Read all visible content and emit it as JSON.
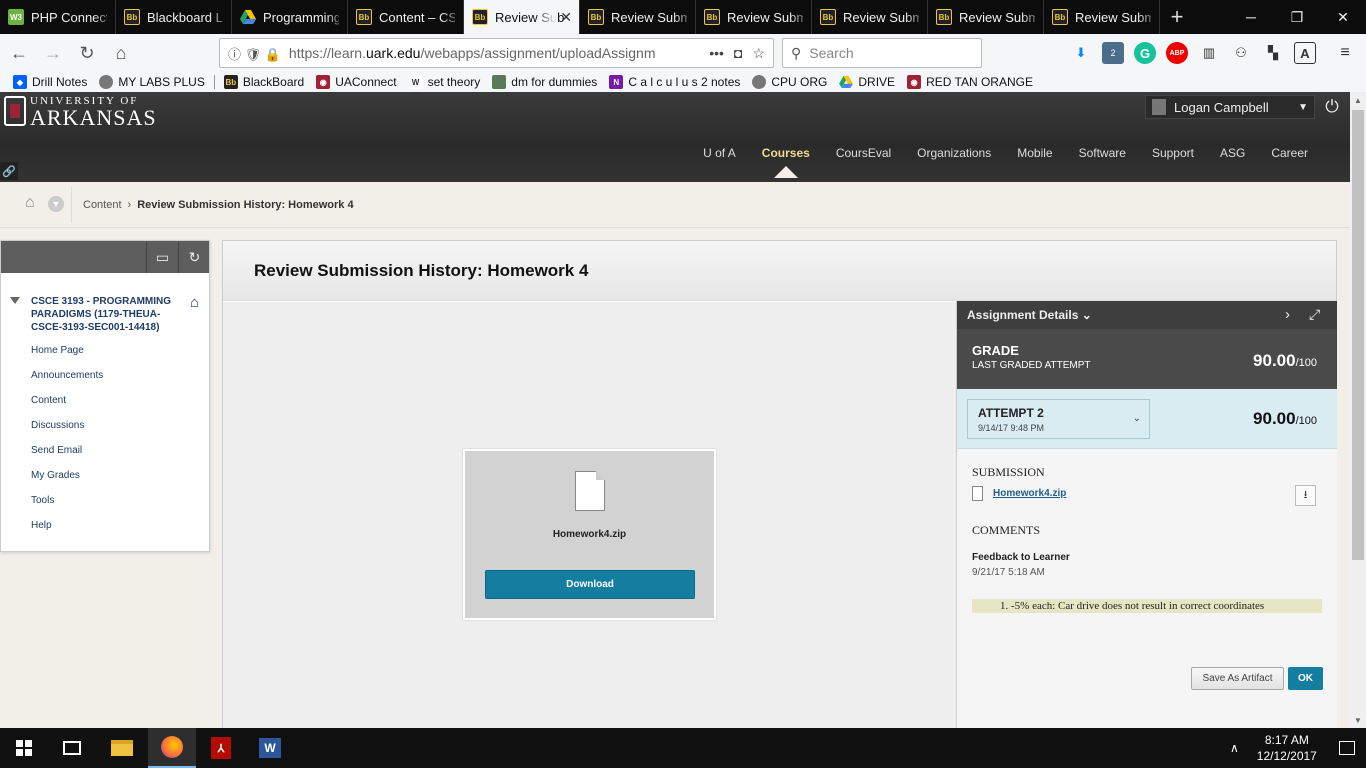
{
  "browser": {
    "tabs": [
      {
        "label": "PHP Connect",
        "favicon": "php-icon",
        "active": false
      },
      {
        "label": "Blackboard Le",
        "favicon": "blackboard-icon",
        "active": false
      },
      {
        "label": "Programming",
        "favicon": "google-drive-icon",
        "active": false
      },
      {
        "label": "Content – CSC",
        "favicon": "blackboard-icon",
        "active": false
      },
      {
        "label": "Review Sub",
        "favicon": "blackboard-icon",
        "active": true
      },
      {
        "label": "Review Subm",
        "favicon": "blackboard-icon",
        "active": false
      },
      {
        "label": "Review Subm",
        "favicon": "blackboard-icon",
        "active": false
      },
      {
        "label": "Review Submi",
        "favicon": "blackboard-icon",
        "active": false
      },
      {
        "label": "Review Subm",
        "favicon": "blackboard-icon",
        "active": false
      },
      {
        "label": "Review Subm",
        "favicon": "blackboard-icon",
        "active": false
      }
    ],
    "url_prefix": "https://learn.",
    "url_domain": "uark.edu",
    "url_rest": "/webapps/assignment/uploadAssignm",
    "search_placeholder": "Search",
    "bookmarks": [
      {
        "label": "Drill Notes",
        "icon": "dropbox-icon",
        "color": "#0061ff"
      },
      {
        "label": "MY LABS PLUS",
        "icon": "globe-icon",
        "color": "#666666"
      },
      {
        "label": "BlackBoard",
        "icon": "blackboard-icon",
        "color": "#222222"
      },
      {
        "label": "UAConnect",
        "icon": "razorback-icon",
        "color": "#9d2235"
      },
      {
        "label": "set theory",
        "icon": "wiki-icon",
        "color": "#444444"
      },
      {
        "label": "dm for dummies",
        "icon": "book-icon",
        "color": "#5a7a5a"
      },
      {
        "label": "C a l c u l u s 2 notes",
        "icon": "onenote-icon",
        "color": "#7719aa"
      },
      {
        "label": "CPU ORG",
        "icon": "globe-icon",
        "color": "#666666"
      },
      {
        "label": "DRIVE",
        "icon": "google-drive-icon",
        "color": "#1fa463"
      },
      {
        "label": "RED TAN ORANGE",
        "icon": "razorback-icon",
        "color": "#9d2235"
      }
    ],
    "extensions": {
      "badge_count": "2",
      "grammarly": "G",
      "adblock": "ABP",
      "a_icon": "A"
    }
  },
  "bb": {
    "logo_line1": "UNIVERSITY OF",
    "logo_line2": "ARKANSAS",
    "user_name": "Logan Campbell",
    "nav": [
      "U of A",
      "Courses",
      "CoursEval",
      "Organizations",
      "Mobile",
      "Software",
      "Support",
      "ASG",
      "Career"
    ],
    "nav_active": "Courses",
    "breadcrumb": {
      "parent": "Content",
      "current": "Review Submission History: Homework 4"
    }
  },
  "course_menu": {
    "title": "CSCE 3193 - PROGRAMMING PARADIGMS (1179-THEUA-CSCE-3193-SEC001-14418)",
    "items": [
      "Home Page",
      "Announcements",
      "Content",
      "Discussions",
      "Send Email",
      "My Grades",
      "Tools",
      "Help"
    ]
  },
  "main": {
    "title": "Review Submission History: Homework 4",
    "file_name": "Homework4.zip",
    "download_label": "Download"
  },
  "panel": {
    "header": "Assignment Details",
    "grade_label": "GRADE",
    "grade_sub": "LAST GRADED ATTEMPT",
    "grade_value": "90.00",
    "grade_max": "/100",
    "attempt_label": "ATTEMPT 2",
    "attempt_date": "9/14/17 9:48 PM",
    "attempt_value": "90.00",
    "attempt_max": "/100",
    "submission_label": "SUBMISSION",
    "submission_file": "Homework4.zip",
    "comments_label": "COMMENTS",
    "feedback_title": "Feedback to Learner",
    "feedback_date": "9/21/17 5:18 AM",
    "feedback_note": "1. -5% each: Car drive does not result in correct coordinates",
    "save_artifact_label": "Save As Artifact",
    "ok_label": "OK"
  },
  "taskbar": {
    "time": "8:17 AM",
    "date": "12/12/2017"
  },
  "colors": {
    "accent_blue": "#137ea0",
    "bb_header": "#333333",
    "attempt_bg": "#d8ecf2",
    "nav_active": "#f3d98c"
  }
}
